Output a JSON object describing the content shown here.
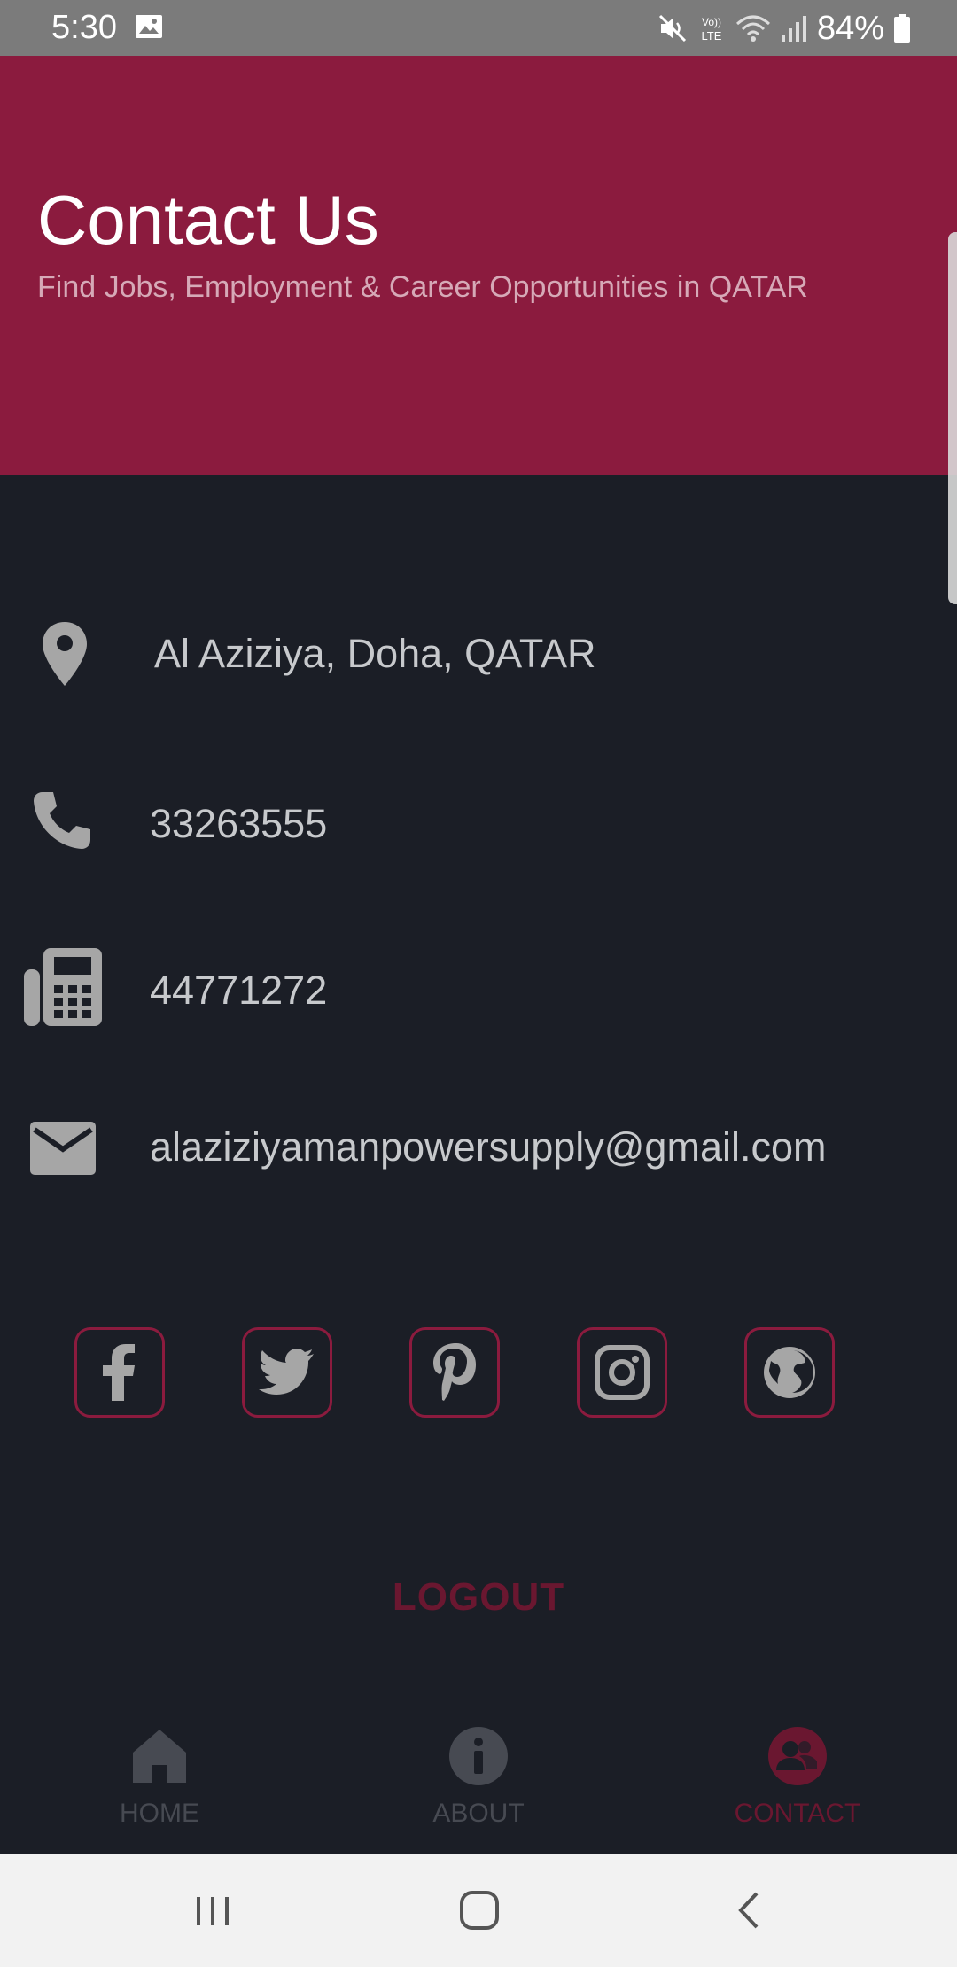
{
  "status_bar": {
    "time": "5:30",
    "battery": "84%",
    "icons": [
      "image-icon",
      "mute-icon",
      "volte-icon",
      "wifi-icon",
      "signal-icon",
      "battery-icon"
    ]
  },
  "header": {
    "title": "Contact Us",
    "subtitle": "Find Jobs, Employment & Career Opportunities in QATAR"
  },
  "contact": {
    "address": "Al Aziziya, Doha, QATAR",
    "phone": "33263555",
    "fax": "44771272",
    "email": "alaziziyamanpowersupply@gmail.com"
  },
  "social": [
    "facebook-icon",
    "twitter-icon",
    "pinterest-icon",
    "instagram-icon",
    "globe-icon"
  ],
  "logout_label": "LOGOUT",
  "bottom_nav": {
    "items": [
      {
        "label": "HOME",
        "icon": "home-icon",
        "active": false
      },
      {
        "label": "ABOUT",
        "icon": "info-icon",
        "active": false
      },
      {
        "label": "CONTACT",
        "icon": "contacts-icon",
        "active": true
      }
    ]
  },
  "colors": {
    "header_bg": "#8b1b3e",
    "page_bg": "#1b1e26",
    "accent": "#8b1b3e",
    "icon_gray": "#a6a6a6",
    "inactive_nav": "#474a52"
  },
  "system_nav": [
    "recents-icon",
    "home-button-icon",
    "back-icon"
  ]
}
